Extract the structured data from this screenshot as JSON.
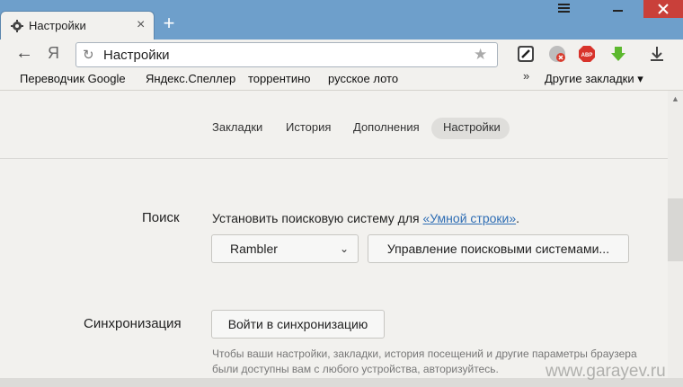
{
  "tab": {
    "title": "Настройки",
    "close": "×"
  },
  "new_tab": "+",
  "toolbar": {
    "back": "←",
    "ya": "Я",
    "url": "Настройки"
  },
  "bookmarks": {
    "items": [
      "Переводчик Google",
      "Яндекс.Спеллер",
      "торрентино",
      "русское лото"
    ],
    "more": "»",
    "other": "Другие закладки ▾"
  },
  "settings_nav": [
    "Закладки",
    "История",
    "Дополнения",
    "Настройки"
  ],
  "search": {
    "label": "Поиск",
    "desc_prefix": "Установить поисковую систему для ",
    "desc_link": "«Умной строки»",
    "desc_suffix": ".",
    "engine": "Rambler",
    "manage_button": "Управление поисковыми системами..."
  },
  "sync": {
    "label": "Синхронизация",
    "button": "Войти в синхронизацию",
    "hint_line1": "Чтобы ваши настройки, закладки, история посещений и другие параметры браузера",
    "hint_line2": "были доступны вам с любого устройства, авторизуйтесь."
  },
  "watermark": "www.garayev.ru",
  "colors": {
    "titlebar": "#6e9fcb",
    "close_button": "#c9403a",
    "link": "#2e6db4",
    "page_bg": "#f2f1ee"
  },
  "icons": [
    "gear-icon",
    "hamburger-menu-icon",
    "minimize-icon",
    "close-icon",
    "reload-icon",
    "star-icon",
    "download-icon",
    "adblock-icon"
  ]
}
